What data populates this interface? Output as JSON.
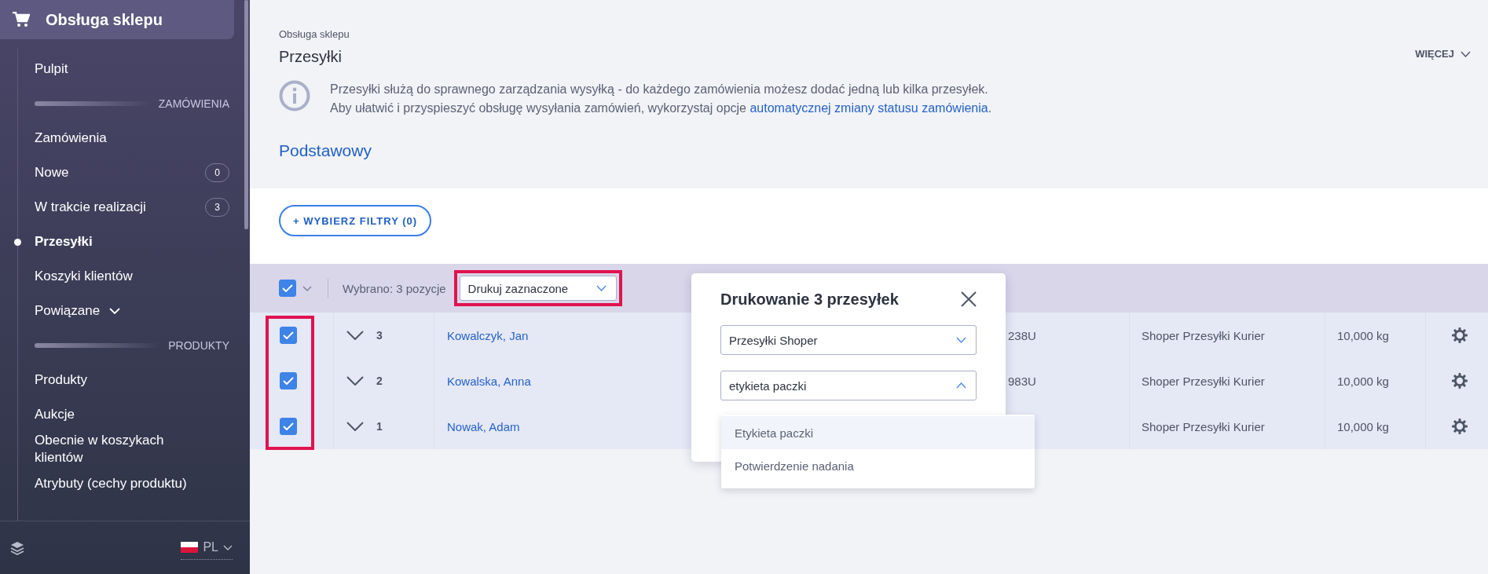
{
  "sidebar": {
    "header": "Obsługa sklepu",
    "items": [
      {
        "kind": "link",
        "label": "Pulpit",
        "selected": false
      },
      {
        "kind": "section",
        "label": "ZAMÓWIENIA"
      },
      {
        "kind": "link",
        "label": "Zamówienia",
        "selected": false
      },
      {
        "kind": "link",
        "label": "Nowe",
        "badge": "0",
        "selected": false
      },
      {
        "kind": "link",
        "label": "W trakcie realizacji",
        "badge": "3",
        "selected": false
      },
      {
        "kind": "link",
        "label": "Przesyłki",
        "selected": true
      },
      {
        "kind": "link",
        "label": "Koszyki klientów",
        "selected": false
      },
      {
        "kind": "group",
        "label": "Powiązane",
        "expanded": false,
        "selected": false
      },
      {
        "kind": "section",
        "label": "PRODUKTY"
      },
      {
        "kind": "link",
        "label": "Produkty",
        "selected": false
      },
      {
        "kind": "link",
        "label": "Aukcje",
        "selected": false
      },
      {
        "kind": "link",
        "label": "Obecnie w koszykach klientów",
        "selected": false
      },
      {
        "kind": "link",
        "label": "Atrybuty (cechy produktu)",
        "selected": false
      }
    ],
    "language": "PL"
  },
  "breadcrumb": "Obsługa sklepu",
  "title": "Przesyłki",
  "more_menu": "WIĘCEJ",
  "info": {
    "line1": "Przesyłki służą do sprawnego zarządzania wysyłką - do każdego zamówienia możesz dodać jedną lub kilka przesyłek.",
    "line2": "Aby ułatwić i przyspieszyć obsługę wysyłania zamówień, wykorzystaj opcje ",
    "link": "automatycznej zmiany statusu zamówienia",
    "line2_end": "."
  },
  "tabs": [
    {
      "label": "Podstawowy",
      "selected": true
    }
  ],
  "filter_button": "+ WYBIERZ FILTRY (0)",
  "bulk_bar": {
    "all_checked": true,
    "selection_text": "Wybrano: 3 pozycje",
    "action": "Drukuj zaznaczone",
    "action_highlighted": true
  },
  "table": {
    "checkbox_highlighted": true,
    "rows": [
      {
        "checked": true,
        "number": "3",
        "customer": "Kowalczyk, Jan",
        "column_5": "238U",
        "carrier": "Shoper Przesyłki Kurier",
        "weight": "10,000 kg"
      },
      {
        "checked": true,
        "number": "2",
        "customer": "Kowalska, Anna",
        "column_5": "983U",
        "carrier": "Shoper Przesyłki Kurier",
        "weight": "10,000 kg"
      },
      {
        "checked": true,
        "number": "1",
        "customer": "Nowak, Adam",
        "carrier": "Shoper Przesyłki Kurier",
        "weight": "10,000 kg"
      }
    ]
  },
  "print_dialog": {
    "title": "Drukowanie 3 przesyłek",
    "fields": [
      {
        "value": "Przesyłki Shoper",
        "open": false
      },
      {
        "value": "etykieta paczki",
        "open": true
      }
    ],
    "options": [
      {
        "label": "Etykieta paczki",
        "selected": true
      },
      {
        "label": "Potwierdzenie nadania",
        "selected": false
      }
    ]
  }
}
